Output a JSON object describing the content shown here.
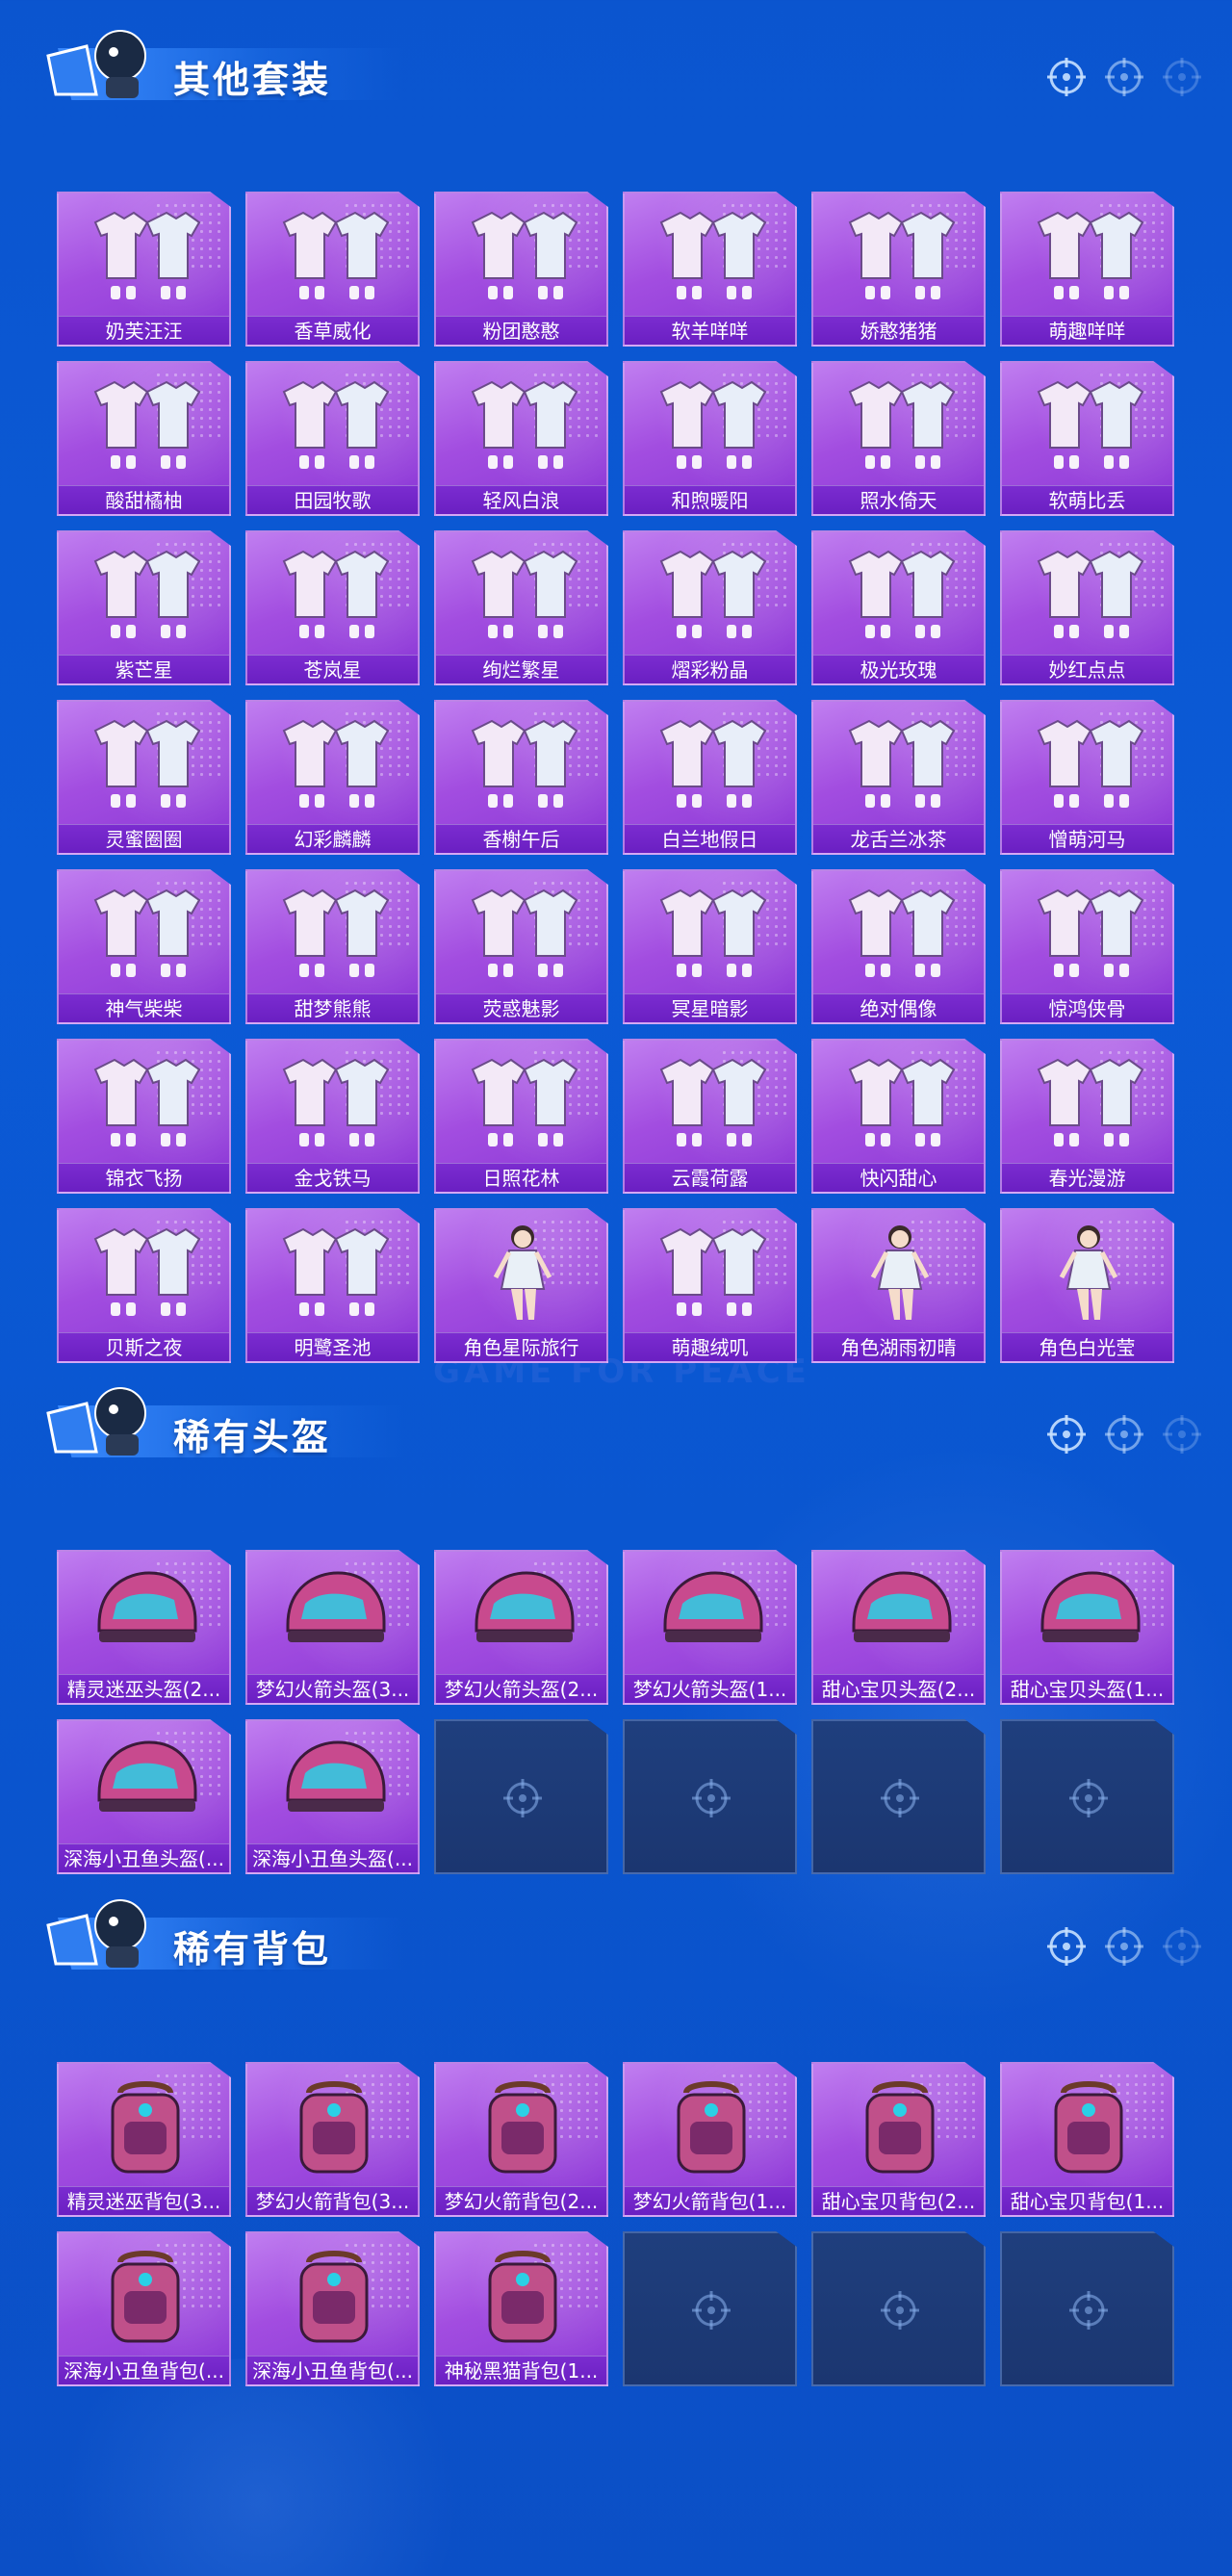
{
  "colors": {
    "background": "#0b55cf",
    "card_purple": "#a24de0",
    "label_purple": "#6a1fc2",
    "empty_slot": "#1f3f7e"
  },
  "sections": [
    {
      "title": "其他套装",
      "items": [
        {
          "label": "奶芙汪汪",
          "icon": "outfit-icon"
        },
        {
          "label": "香草威化",
          "icon": "outfit-icon"
        },
        {
          "label": "粉团憨憨",
          "icon": "outfit-icon"
        },
        {
          "label": "软羊咩咩",
          "icon": "outfit-icon"
        },
        {
          "label": "娇憨猪猪",
          "icon": "outfit-icon"
        },
        {
          "label": "萌趣咩咩",
          "icon": "outfit-icon"
        },
        {
          "label": "酸甜橘柚",
          "icon": "outfit-icon"
        },
        {
          "label": "田园牧歌",
          "icon": "outfit-icon"
        },
        {
          "label": "轻风白浪",
          "icon": "outfit-icon"
        },
        {
          "label": "和煦暖阳",
          "icon": "outfit-icon"
        },
        {
          "label": "照水倚天",
          "icon": "outfit-icon"
        },
        {
          "label": "软萌比丢",
          "icon": "outfit-icon"
        },
        {
          "label": "紫芒星",
          "icon": "outfit-icon"
        },
        {
          "label": "苍岚星",
          "icon": "outfit-icon"
        },
        {
          "label": "绚烂繁星",
          "icon": "outfit-icon"
        },
        {
          "label": "熠彩粉晶",
          "icon": "outfit-icon"
        },
        {
          "label": "极光玫瑰",
          "icon": "outfit-icon"
        },
        {
          "label": "妙红点点",
          "icon": "outfit-icon"
        },
        {
          "label": "灵蜜圈圈",
          "icon": "outfit-icon"
        },
        {
          "label": "幻彩麟麟",
          "icon": "outfit-icon"
        },
        {
          "label": "香榭午后",
          "icon": "outfit-icon"
        },
        {
          "label": "白兰地假日",
          "icon": "outfit-icon"
        },
        {
          "label": "龙舌兰冰茶",
          "icon": "outfit-icon"
        },
        {
          "label": "憎萌河马",
          "icon": "outfit-icon"
        },
        {
          "label": "神气柴柴",
          "icon": "outfit-icon"
        },
        {
          "label": "甜梦熊熊",
          "icon": "outfit-icon"
        },
        {
          "label": "荧惑魅影",
          "icon": "outfit-icon"
        },
        {
          "label": "冥星暗影",
          "icon": "outfit-icon"
        },
        {
          "label": "绝对偶像",
          "icon": "outfit-icon"
        },
        {
          "label": "惊鸿侠骨",
          "icon": "outfit-icon"
        },
        {
          "label": "锦衣飞扬",
          "icon": "outfit-icon"
        },
        {
          "label": "金戈铁马",
          "icon": "outfit-icon"
        },
        {
          "label": "日照花林",
          "icon": "outfit-icon"
        },
        {
          "label": "云霞荷露",
          "icon": "outfit-icon"
        },
        {
          "label": "快闪甜心",
          "icon": "outfit-icon"
        },
        {
          "label": "春光漫游",
          "icon": "outfit-icon"
        },
        {
          "label": "贝斯之夜",
          "icon": "outfit-icon"
        },
        {
          "label": "明鹭圣池",
          "icon": "outfit-icon"
        },
        {
          "label": "角色星际旅行",
          "icon": "character-icon"
        },
        {
          "label": "萌趣绒叽",
          "icon": "outfit-icon"
        },
        {
          "label": "角色湖雨初晴",
          "icon": "character-icon"
        },
        {
          "label": "角色白光莹",
          "icon": "character-icon"
        }
      ],
      "empty_slots": 0
    },
    {
      "title": "稀有头盔",
      "items": [
        {
          "label": "精灵迷巫头盔(2...",
          "icon": "helmet-icon"
        },
        {
          "label": "梦幻火箭头盔(3...",
          "icon": "helmet-icon"
        },
        {
          "label": "梦幻火箭头盔(2...",
          "icon": "helmet-icon"
        },
        {
          "label": "梦幻火箭头盔(1...",
          "icon": "helmet-icon"
        },
        {
          "label": "甜心宝贝头盔(2...",
          "icon": "helmet-icon"
        },
        {
          "label": "甜心宝贝头盔(1...",
          "icon": "helmet-icon"
        },
        {
          "label": "深海小丑鱼头盔(...",
          "icon": "helmet-icon"
        },
        {
          "label": "深海小丑鱼头盔(...",
          "icon": "helmet-icon"
        }
      ],
      "empty_slots": 4
    },
    {
      "title": "稀有背包",
      "items": [
        {
          "label": "精灵迷巫背包(3...",
          "icon": "backpack-icon"
        },
        {
          "label": "梦幻火箭背包(3...",
          "icon": "backpack-icon"
        },
        {
          "label": "梦幻火箭背包(2...",
          "icon": "backpack-icon"
        },
        {
          "label": "梦幻火箭背包(1...",
          "icon": "backpack-icon"
        },
        {
          "label": "甜心宝贝背包(2...",
          "icon": "backpack-icon"
        },
        {
          "label": "甜心宝贝背包(1...",
          "icon": "backpack-icon"
        },
        {
          "label": "深海小丑鱼背包(...",
          "icon": "backpack-icon"
        },
        {
          "label": "深海小丑鱼背包(...",
          "icon": "backpack-icon"
        },
        {
          "label": "神秘黑猫背包(1...",
          "icon": "backpack-icon"
        }
      ],
      "empty_slots": 3
    }
  ]
}
